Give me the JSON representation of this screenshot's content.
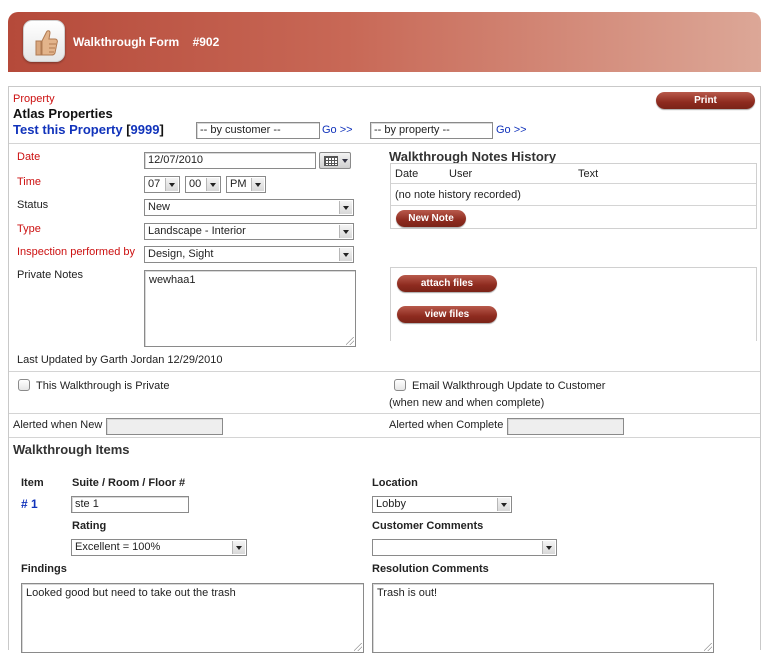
{
  "header": {
    "title": "Walkthrough Form",
    "number": "#902",
    "icon": "thumbs-up-icon"
  },
  "print_label": "Print",
  "property": {
    "label": "Property",
    "company": "Atlas Properties",
    "name": "Test this Property",
    "code_open": "[",
    "code": "9999",
    "code_close": "]",
    "by_customer": "-- by customer --",
    "by_property": "-- by property --",
    "go_label": "Go >>"
  },
  "form": {
    "date_label": "Date",
    "date_value": "12/07/2010",
    "time_label": "Time",
    "hour": "07",
    "minute": "00",
    "ampm": "PM",
    "status_label": "Status",
    "status_value": "New",
    "type_label": "Type",
    "type_value": "Landscape - Interior",
    "inspection_label": "Inspection performed by",
    "inspection_value": "Design, Sight",
    "private_notes_label": "Private Notes",
    "private_notes_value": "wewhaa1",
    "last_updated": "Last Updated by Garth Jordan 12/29/2010"
  },
  "history": {
    "title": "Walkthrough Notes History",
    "columns": [
      "Date",
      "User",
      "Text"
    ],
    "empty": "(no note history recorded)",
    "new_note_label": "New Note"
  },
  "files": {
    "attach_label": "attach files",
    "view_label": "view files"
  },
  "options": {
    "private_label": "This Walkthrough is Private",
    "email_label": "Email Walkthrough Update to Customer",
    "email_note": "(when new and when complete)",
    "alerted_new_label": "Alerted when New",
    "alerted_complete_label": "Alerted when Complete"
  },
  "items": {
    "title": "Walkthrough Items",
    "item_label": "Item",
    "suite_label": "Suite / Room / Floor #",
    "location_label": "Location",
    "item_number": "# 1",
    "suite_value": "ste 1",
    "location_value": "Lobby",
    "rating_label": "Rating",
    "rating_value": "Excellent = 100%",
    "customer_comments_label": "Customer Comments",
    "customer_comments_value": "",
    "findings_label": "Findings",
    "findings_value": "Looked good but need to take out the trash",
    "resolution_label": "Resolution Comments",
    "resolution_value": "Trash is out!"
  }
}
